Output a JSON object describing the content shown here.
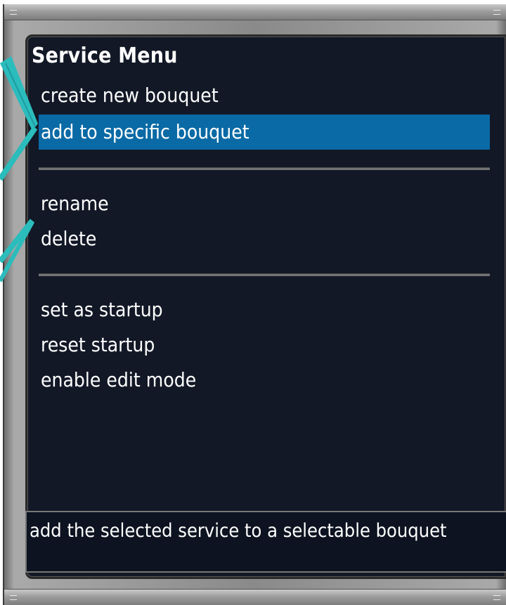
{
  "menu": {
    "title": "Service Menu",
    "items": [
      {
        "label": "create new bouquet",
        "selected": false
      },
      {
        "label": "add to specific bouquet",
        "selected": true
      },
      {
        "label": "rename",
        "selected": false
      },
      {
        "label": "delete",
        "selected": false
      },
      {
        "label": "set as startup",
        "selected": false
      },
      {
        "label": "reset startup",
        "selected": false
      },
      {
        "label": "enable edit mode",
        "selected": false
      }
    ]
  },
  "description": {
    "text": "add the selected service to a selectable bouquet"
  },
  "colors": {
    "panel_background": "#121826",
    "selection_highlight": "#0a6aa5",
    "callout_arrow": "#2bbcbc"
  }
}
